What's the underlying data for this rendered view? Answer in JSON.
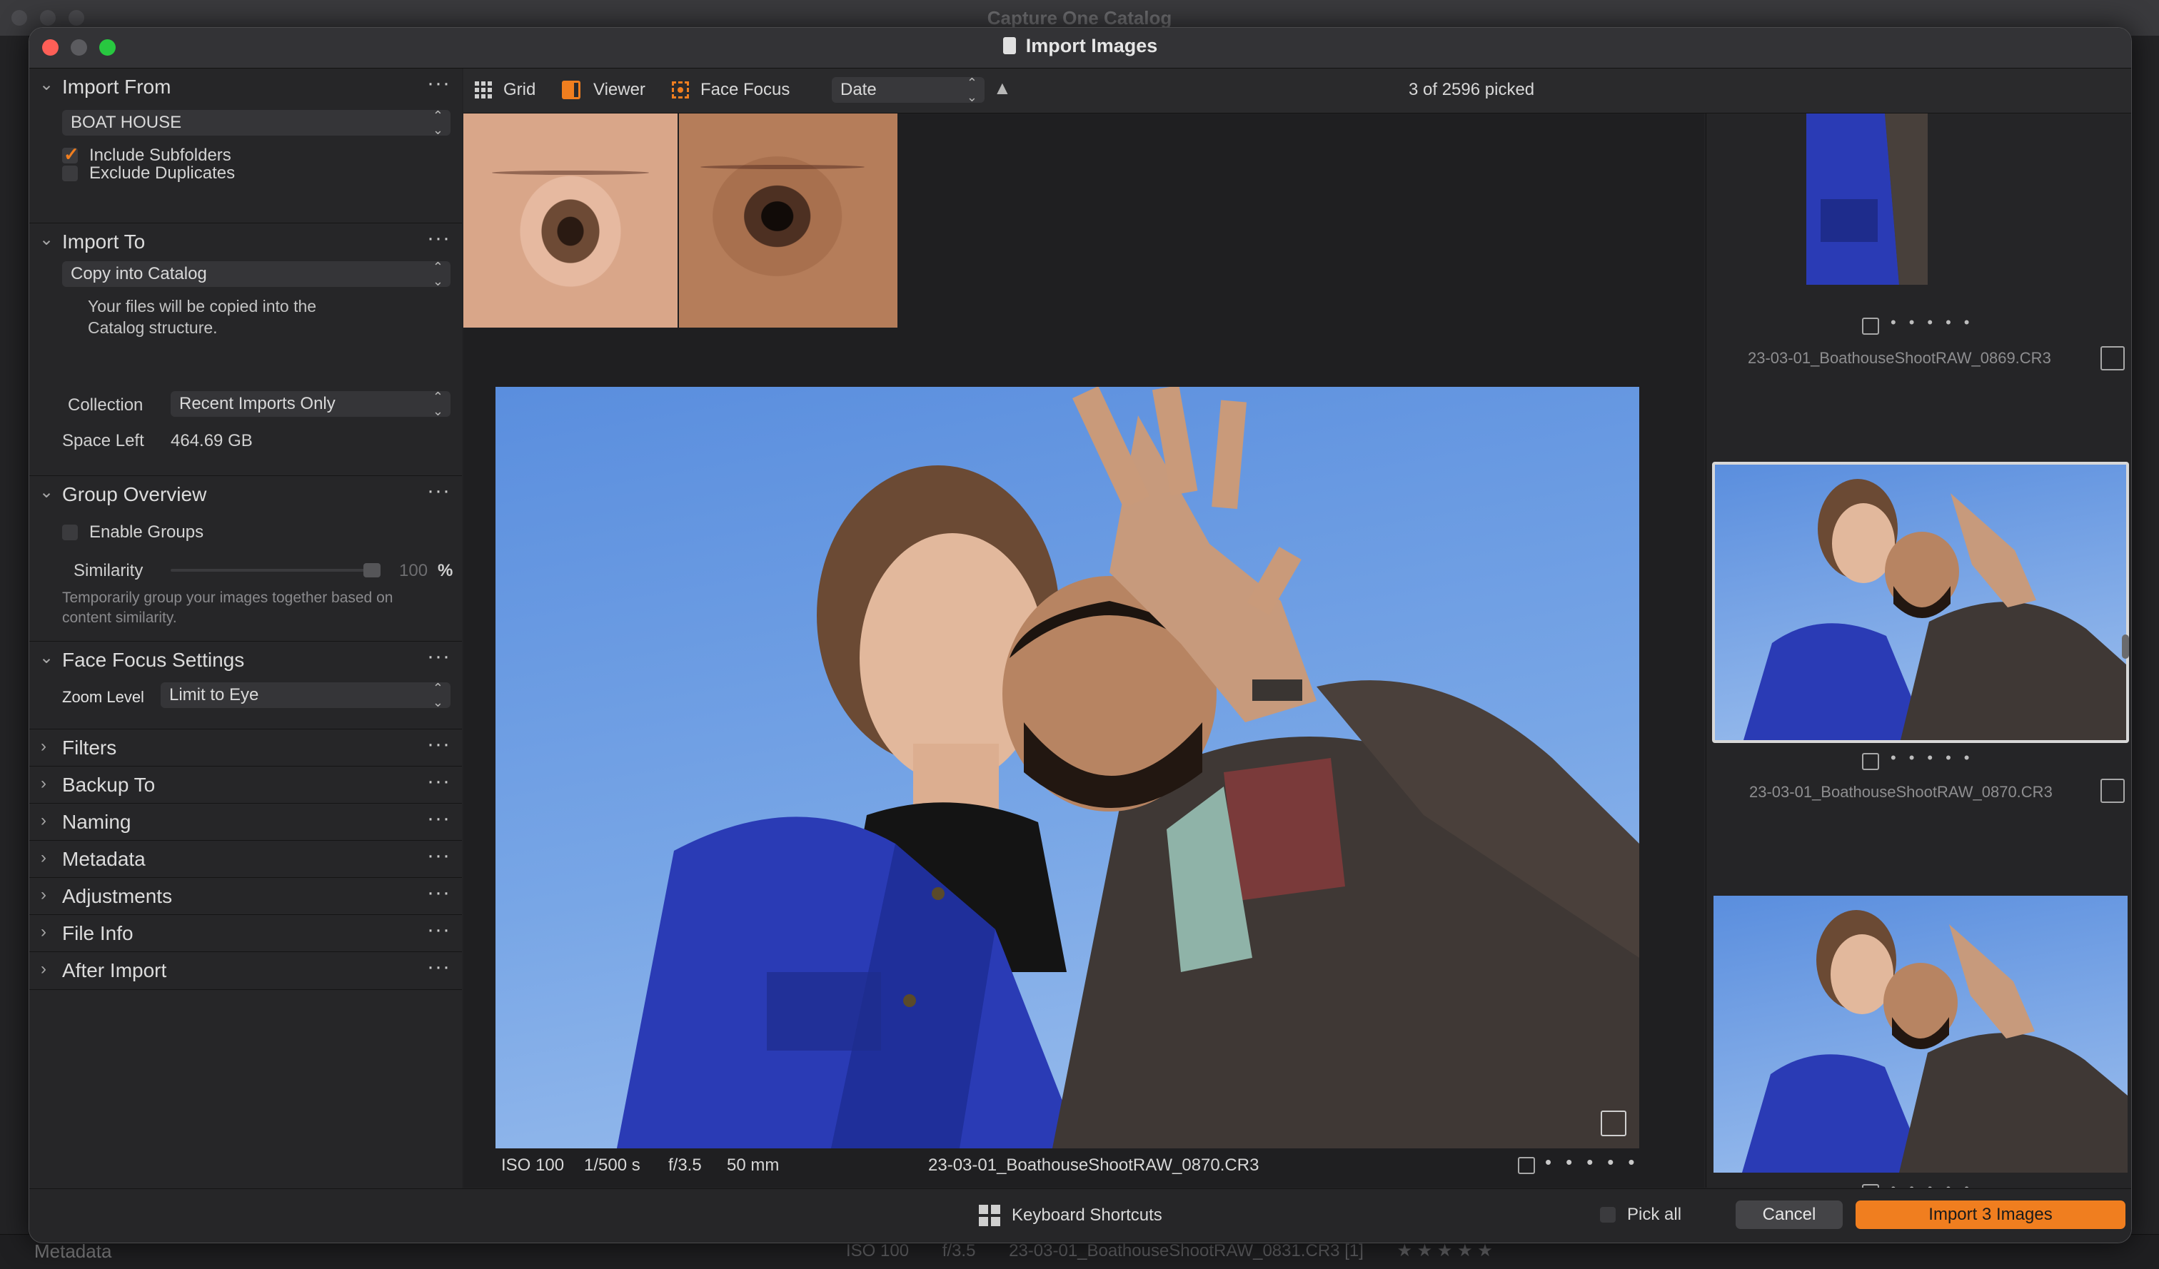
{
  "background_app": {
    "title": "Capture One Catalog",
    "bottom_panel_label": "Metadata",
    "bottom_info": [
      "ISO 100",
      "f/3.5",
      "23-03-01_BoathouseShootRAW_0831.CR3 [1]"
    ]
  },
  "window": {
    "title": "Import Images"
  },
  "left_panel": {
    "import_from": {
      "title": "Import From",
      "source": "BOAT HOUSE",
      "include_subfolders": "Include Subfolders",
      "include_subfolders_checked": true,
      "exclude_duplicates": "Exclude Duplicates",
      "exclude_duplicates_checked": false
    },
    "import_to": {
      "title": "Import To",
      "destination": "Copy into Catalog",
      "note_line1": "Your files will be copied into the",
      "note_line2": "Catalog structure.",
      "collection_label": "Collection",
      "collection_value": "Recent Imports Only",
      "space_left_label": "Space Left",
      "space_left_value": "464.69 GB"
    },
    "group_overview": {
      "title": "Group Overview",
      "enable_groups": "Enable Groups",
      "enable_groups_checked": false,
      "similarity_label": "Similarity",
      "similarity_value": "100",
      "similarity_unit": "%",
      "note_line1": "Temporarily group your images together based on",
      "note_line2": "content similarity."
    },
    "face_focus": {
      "title": "Face Focus Settings",
      "zoom_label": "Zoom Level",
      "zoom_value": "Limit to Eye"
    },
    "collapsed_sections": [
      "Filters",
      "Backup To",
      "Naming",
      "Metadata",
      "Adjustments",
      "File Info",
      "After Import"
    ]
  },
  "toolbar": {
    "grid_label": "Grid",
    "viewer_label": "Viewer",
    "face_focus_label": "Face Focus",
    "sort_value": "Date",
    "picked_status": "3 of 2596 picked"
  },
  "viewer": {
    "iso": "ISO 100",
    "shutter": "1/500 s",
    "aperture": "f/3.5",
    "focal_length": "50 mm",
    "filename": "23-03-01_BoathouseShootRAW_0870.CR3"
  },
  "filmstrip": {
    "items": [
      {
        "filename": "23-03-01_BoathouseShootRAW_0869.CR3"
      },
      {
        "filename": "23-03-01_BoathouseShootRAW_0870.CR3"
      }
    ]
  },
  "bottom_bar": {
    "keyboard_shortcuts": "Keyboard Shortcuts",
    "pick_all": "Pick all",
    "cancel": "Cancel",
    "import": "Import 3 Images"
  },
  "colors": {
    "accent": "#f07e1f",
    "close": "#fe5f57",
    "maximize": "#28c840"
  }
}
